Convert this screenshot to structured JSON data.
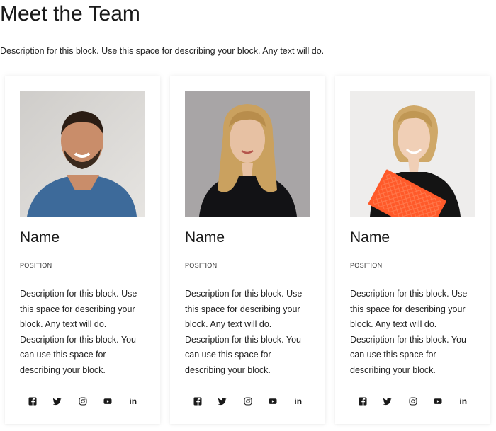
{
  "page": {
    "title": "Meet the Team",
    "description": "Description for this block. Use this space for describing your block. Any text will do."
  },
  "members": [
    {
      "name": "Name",
      "position": "POSITION",
      "description": "Description for this block. Use this space for describing your block. Any text will do. Description for this block. You can use this space for describing your block.",
      "photo": "man-smiling-blue-shirt"
    },
    {
      "name": "Name",
      "position": "POSITION",
      "description": "Description for this block. Use this space for describing your block. Any text will do. Description for this block. You can use this space for describing your block.",
      "photo": "woman-long-blonde-hair-dark-top"
    },
    {
      "name": "Name",
      "position": "POSITION",
      "description": "Description for this block. Use this space for describing your block. Any text will do. Description for this block. You can use this space for describing your block.",
      "photo": "woman-blonde-holding-orange-folder"
    }
  ],
  "social_icons": [
    "facebook-icon",
    "twitter-icon",
    "instagram-icon",
    "youtube-icon",
    "linkedin-icon"
  ],
  "social_linkedin_text": "in",
  "colors": {
    "text": "#1a1a1a",
    "accent_orange": "#ff5a2a"
  }
}
